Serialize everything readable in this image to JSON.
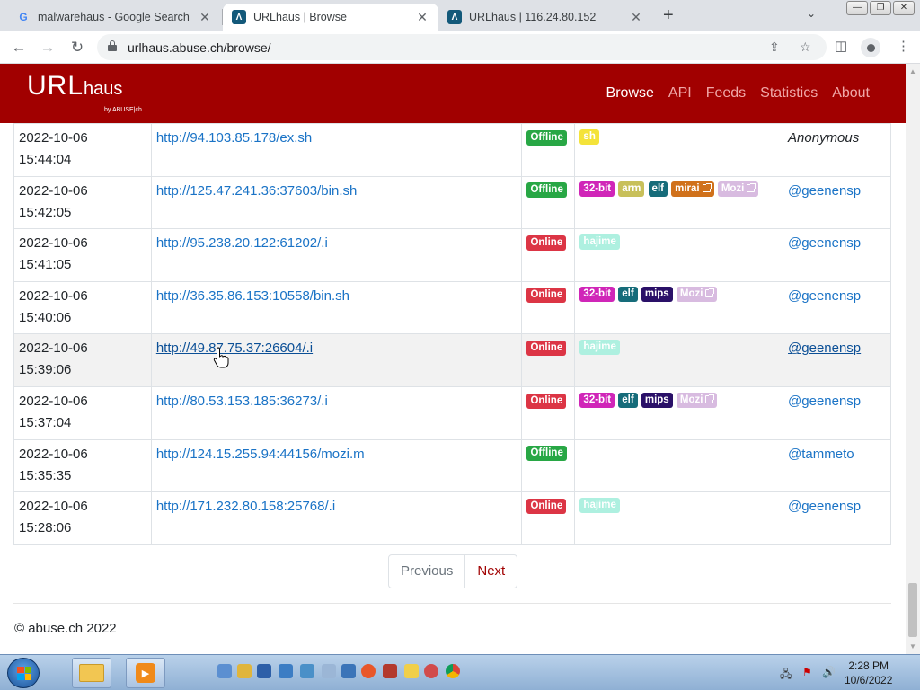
{
  "browser": {
    "tabs": [
      {
        "title": "malwarehaus - Google Search",
        "icon": "G"
      },
      {
        "title": "URLhaus | Browse",
        "icon": "Λ"
      },
      {
        "title": "URLhaus | 116.24.80.152",
        "icon": "Λ"
      }
    ],
    "address": "urlhaus.abuse.ch/browse/"
  },
  "site": {
    "logo_main": "URL",
    "logo_sub": "haus",
    "logo_by": "by ABUSE|ch",
    "nav": [
      "Browse",
      "API",
      "Feeds",
      "Statistics",
      "About"
    ]
  },
  "rows": [
    {
      "date": "2022-10-06",
      "time": "15:44:04",
      "url": "http://94.103.85.178/ex.sh",
      "status": "Offline",
      "tags": [
        "sh"
      ],
      "reporter": "Anonymous"
    },
    {
      "date": "2022-10-06",
      "time": "15:42:05",
      "url": "http://125.47.241.36:37603/bin.sh",
      "status": "Offline",
      "tags": [
        "32-bit",
        "arm",
        "elf",
        "mirai",
        "Mozi"
      ],
      "reporter": "@geenensp"
    },
    {
      "date": "2022-10-06",
      "time": "15:41:05",
      "url": "http://95.238.20.122:61202/.i",
      "status": "Online",
      "tags": [
        "hajime"
      ],
      "reporter": "@geenensp"
    },
    {
      "date": "2022-10-06",
      "time": "15:40:06",
      "url": "http://36.35.86.153:10558/bin.sh",
      "status": "Online",
      "tags": [
        "32-bit",
        "elf",
        "mips",
        "Mozi"
      ],
      "reporter": "@geenensp"
    },
    {
      "date": "2022-10-06",
      "time": "15:39:06",
      "url": "http://49.87.75.37:26604/.i",
      "status": "Online",
      "tags": [
        "hajime"
      ],
      "reporter": "@geenensp"
    },
    {
      "date": "2022-10-06",
      "time": "15:37:04",
      "url": "http://80.53.153.185:36273/.i",
      "status": "Online",
      "tags": [
        "32-bit",
        "elf",
        "mips",
        "Mozi"
      ],
      "reporter": "@geenensp"
    },
    {
      "date": "2022-10-06",
      "time": "15:35:35",
      "url": "http://124.15.255.94:44156/mozi.m",
      "status": "Offline",
      "tags": [],
      "reporter": "@tammeto"
    },
    {
      "date": "2022-10-06",
      "time": "15:28:06",
      "url": "http://171.232.80.158:25768/.i",
      "status": "Online",
      "tags": [
        "hajime"
      ],
      "reporter": "@geenensp"
    }
  ],
  "pagination": {
    "previous": "Previous",
    "next": "Next"
  },
  "footer": "© abuse.ch 2022",
  "taskbar": {
    "time": "2:28 PM",
    "date": "10/6/2022"
  },
  "colors": {
    "header": "#a10000",
    "online": "#dc3545",
    "offline": "#28a745",
    "link": "#1a73c6"
  }
}
